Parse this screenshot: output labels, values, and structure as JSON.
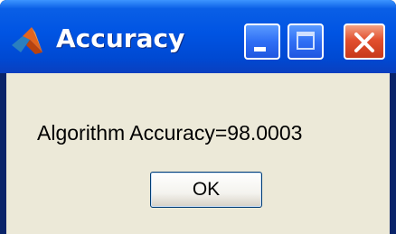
{
  "window": {
    "title": "Accuracy",
    "app_icon": "matlab-logo-icon",
    "controls": {
      "minimize_icon": "minimize-icon",
      "maximize_icon": "maximize-icon",
      "close_icon": "close-icon"
    }
  },
  "dialog": {
    "message": "Algorithm Accuracy=98.0003",
    "ok_label": "OK"
  },
  "colors": {
    "titlebar": "#0054e3",
    "client_background": "#ece9d8",
    "close_button": "#e2502f"
  }
}
